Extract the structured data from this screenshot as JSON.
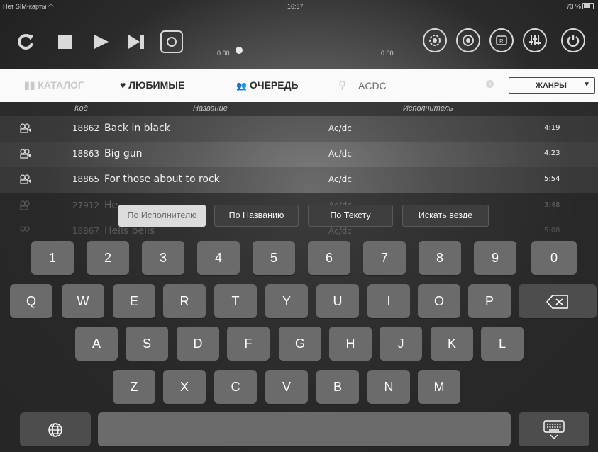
{
  "status": {
    "carrier": "Нет SIM-карты",
    "time": "16:37",
    "battery": "73 %"
  },
  "player": {
    "elapsed": "0:00",
    "remaining": "0:00"
  },
  "tabs": {
    "catalog": "КАТАЛОГ",
    "favorites": "ЛЮБИМЫЕ",
    "queue": "ОЧЕРЕДЬ"
  },
  "search": {
    "value": "ACDC",
    "genres": "ЖАНРЫ"
  },
  "columns": {
    "code": "Код",
    "title": "Название",
    "artist": "Исполнитель"
  },
  "songs": [
    {
      "code": "18862",
      "title": "Back in black",
      "artist": "Ac/dc",
      "duration": "4:19"
    },
    {
      "code": "18863",
      "title": "Big gun",
      "artist": "Ac/dc",
      "duration": "4:23"
    },
    {
      "code": "18865",
      "title": "For those about to rock",
      "artist": "Ac/dc",
      "duration": "5:54"
    },
    {
      "code": "27912",
      "title": "He...",
      "artist": "Ac/dc",
      "duration": "3:48"
    },
    {
      "code": "18867",
      "title": "Hells bells",
      "artist": "Ac/dc",
      "duration": "5:08"
    }
  ],
  "search_scopes": [
    "По Исполнителю",
    "По Названию",
    "По Тексту",
    "Искать везде"
  ],
  "keyboard": {
    "row1": [
      "1",
      "2",
      "3",
      "4",
      "5",
      "6",
      "7",
      "8",
      "9",
      "0"
    ],
    "row2": [
      "Q",
      "W",
      "E",
      "R",
      "T",
      "Y",
      "U",
      "I",
      "O",
      "P"
    ],
    "row3": [
      "A",
      "S",
      "D",
      "F",
      "G",
      "H",
      "J",
      "K",
      "L"
    ],
    "row4": [
      "Z",
      "X",
      "C",
      "V",
      "B",
      "N",
      "M"
    ]
  }
}
